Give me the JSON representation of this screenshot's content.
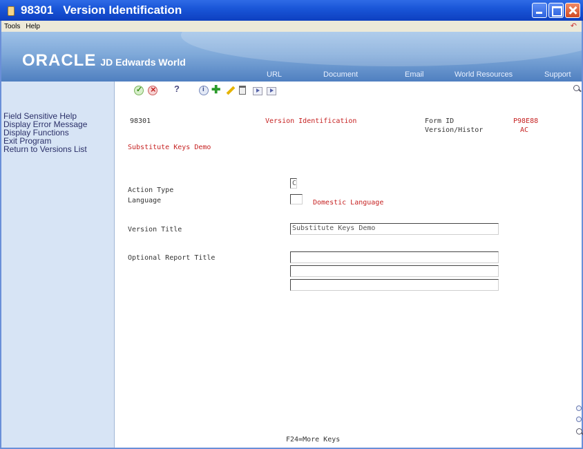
{
  "window": {
    "code": "98301",
    "title": "Version Identification"
  },
  "menubar": {
    "items": [
      "Tools",
      "Help"
    ]
  },
  "banner": {
    "logo_main": "ORACLE",
    "logo_sub": "JD Edwards World",
    "nav": [
      "URL",
      "Document",
      "Email",
      "World Resources",
      "Support"
    ]
  },
  "exits": [
    "Field Sensitive Help",
    "Display Error Message",
    "Display Functions",
    "Exit Program",
    "Return to Versions List"
  ],
  "form": {
    "program": "98301",
    "form_title": "Version Identification",
    "form_id_label": "Form ID",
    "form_id_value": "P98E88",
    "version_label": "Version/Histor",
    "version_value": "AC",
    "subtitle": "Substitute Keys Demo",
    "action_type_label": "Action Type",
    "action_type_value": "C",
    "language_label": "Language",
    "language_value": "",
    "language_desc": "Domestic Language",
    "version_title_label": "Version Title",
    "version_title_value": "Substitute Keys Demo",
    "optional_report_title_label": "Optional Report Title",
    "optional_report_title_values": [
      "",
      "",
      ""
    ],
    "footer": "F24=More Keys"
  }
}
